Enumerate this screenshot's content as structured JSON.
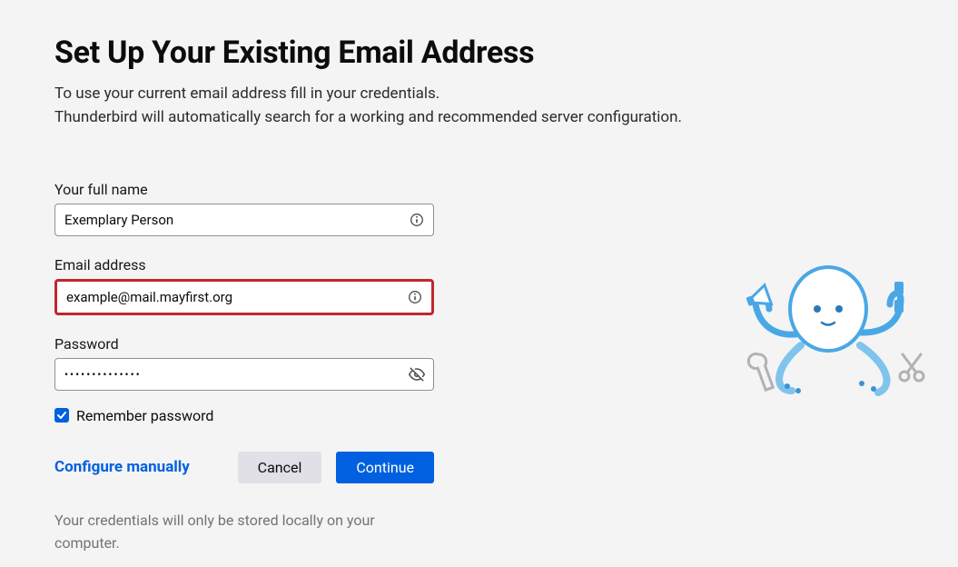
{
  "heading": "Set Up Your Existing Email Address",
  "subtitle_line1": "To use your current email address fill in your credentials.",
  "subtitle_line2": "Thunderbird will automatically search for a working and recommended server configuration.",
  "full_name": {
    "label": "Your full name",
    "value": "Exemplary Person"
  },
  "email": {
    "label": "Email address",
    "value": "example@mail.mayfirst.org"
  },
  "password": {
    "label": "Password",
    "value": "••••••••••••••"
  },
  "remember": {
    "label": "Remember password",
    "checked": true
  },
  "actions": {
    "configure_manually": "Configure manually",
    "cancel": "Cancel",
    "continue": "Continue"
  },
  "footnote": "Your credentials will only be stored locally on your computer."
}
